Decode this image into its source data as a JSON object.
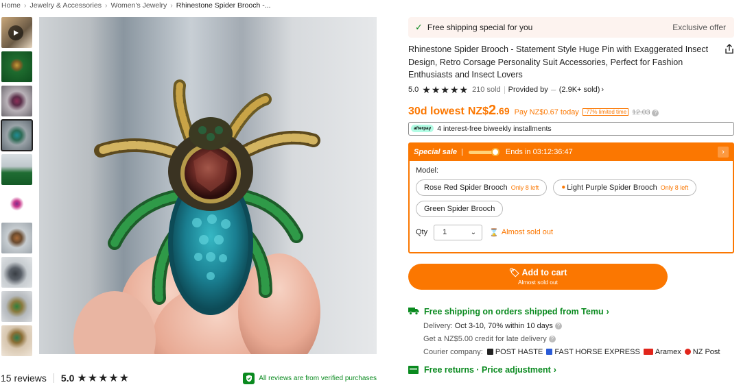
{
  "breadcrumb": {
    "items": [
      "Home",
      "Jewelry & Accessories",
      "Women's Jewelry"
    ],
    "current": "Rhinestone Spider Brooch -..."
  },
  "gallery": {
    "thumbnail_count": 10,
    "active_index": 3
  },
  "reviews": {
    "count_label": "15 reviews",
    "score": "5.0",
    "stars": "★★★★★",
    "verified_text": "All reviews are from verified purchases"
  },
  "shipping_banner": {
    "text": "Free shipping special for you",
    "offer": "Exclusive offer"
  },
  "product": {
    "title": "Rhinestone Spider Brooch - Statement Style Huge Pin with Exaggerated Insect Design, Retro Corsage Personality Suit Accessories, Perfect for Fashion Enthusiasts and Insect Lovers",
    "rating": "5.0",
    "stars": "★★★★★",
    "sold": "210 sold",
    "provided_by": "Provided by",
    "seller_sold": "(2.9K+ sold)"
  },
  "price": {
    "label": "30d lowest",
    "currency": "NZ$",
    "integer": "2",
    "decimal": ".69",
    "pay_today": "Pay NZ$0.67 today",
    "limited": "-77% limited time",
    "original": "12.03"
  },
  "installments": {
    "badge": "afterpay",
    "text": "4 interest-free biweekly installments"
  },
  "sale": {
    "label": "Special sale",
    "ends": "Ends in 03:12:36:47",
    "model_label": "Model:",
    "options": [
      {
        "name": "Rose Red Spider Brooch",
        "left": "Only 8 left"
      },
      {
        "name": "Light Purple Spider Brooch",
        "left": "Only 8 left"
      },
      {
        "name": "Green Spider Brooch",
        "left": ""
      }
    ],
    "qty_label": "Qty",
    "qty_value": "1",
    "almost": "Almost sold out"
  },
  "cart": {
    "label": "Add to cart",
    "sub": "Almost sold out"
  },
  "shipping": {
    "head": "Free shipping on orders shipped from Temu",
    "delivery_label": "Delivery:",
    "delivery_value": "Oct 3-10, 70% within 10 days",
    "credit": "Get a NZ$5.00 credit for late delivery",
    "courier_label": "Courier company:",
    "couriers": [
      "POST HASTE",
      "FAST HORSE EXPRESS",
      "Aramex",
      "NZ Post"
    ]
  },
  "returns": {
    "text": "Free returns · Price adjustment"
  },
  "colors": {
    "accent": "#fb7701",
    "green": "#0a8a1f"
  }
}
